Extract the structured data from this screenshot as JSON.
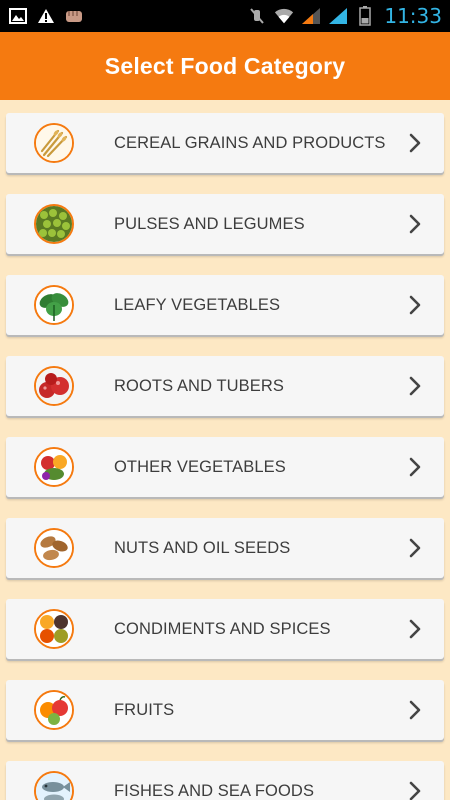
{
  "status_bar": {
    "time": "11:33",
    "left_icons": [
      "image-icon",
      "warning-icon",
      "fist-icon"
    ],
    "right_icons": [
      "mute-icon",
      "wifi-icon",
      "signal-icon",
      "signal-icon",
      "battery-icon"
    ],
    "time_color": "#33b5e5"
  },
  "header": {
    "title": "Select Food Category",
    "color": "#f57a10"
  },
  "categories": [
    {
      "label": "CEREAL GRAINS AND PRODUCTS",
      "icon": "wheat-icon"
    },
    {
      "label": "PULSES AND LEGUMES",
      "icon": "peas-icon"
    },
    {
      "label": "LEAFY VEGETABLES",
      "icon": "spinach-icon"
    },
    {
      "label": "ROOTS AND TUBERS",
      "icon": "radish-icon"
    },
    {
      "label": "OTHER VEGETABLES",
      "icon": "vegetables-icon"
    },
    {
      "label": "NUTS AND OIL SEEDS",
      "icon": "almond-icon"
    },
    {
      "label": "CONDIMENTS AND SPICES",
      "icon": "spices-icon"
    },
    {
      "label": "FRUITS",
      "icon": "fruits-icon"
    },
    {
      "label": "FISHES AND SEA FOODS",
      "icon": "fish-icon"
    }
  ],
  "colors": {
    "background": "#fde8c4",
    "row": "#f6f6f6",
    "text": "#3d3d3d",
    "accent": "#f57a10"
  }
}
